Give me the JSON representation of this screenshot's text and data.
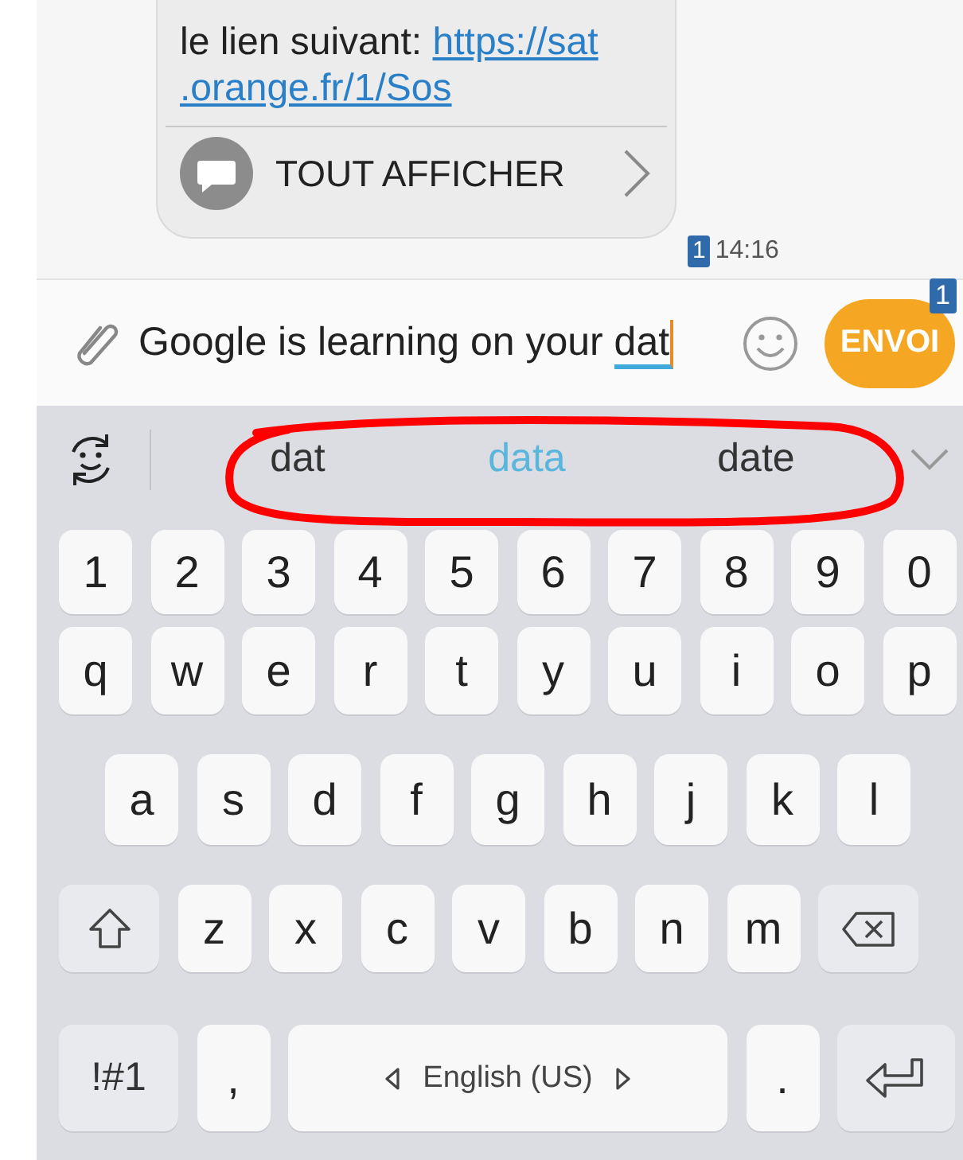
{
  "message": {
    "text": "le lien suivant: ",
    "link_lines": [
      "https://sat",
      ".orange.fr/1/Sos"
    ],
    "action": "TOUT AFFICHER",
    "sim": "1",
    "time": "14:16"
  },
  "compose": {
    "text": "Google is learning on your ",
    "composing": "dat",
    "send": "ENVOI",
    "send_badge": "1"
  },
  "suggestions": [
    {
      "text": "dat",
      "selected": false
    },
    {
      "text": "data",
      "selected": true
    },
    {
      "text": "date",
      "selected": false
    }
  ],
  "annotation": {
    "kind": "ellipse"
  },
  "keyboard": [
    [
      {
        "kind": "char",
        "label": "1"
      },
      {
        "kind": "char",
        "label": "2"
      },
      {
        "kind": "char",
        "label": "3"
      },
      {
        "kind": "char",
        "label": "4"
      },
      {
        "kind": "char",
        "label": "5"
      },
      {
        "kind": "char",
        "label": "6"
      },
      {
        "kind": "char",
        "label": "7"
      },
      {
        "kind": "char",
        "label": "8"
      },
      {
        "kind": "char",
        "label": "9"
      },
      {
        "kind": "char",
        "label": "0"
      }
    ],
    [
      {
        "kind": "char",
        "label": "q"
      },
      {
        "kind": "char",
        "label": "w"
      },
      {
        "kind": "char",
        "label": "e"
      },
      {
        "kind": "char",
        "label": "r"
      },
      {
        "kind": "char",
        "label": "t"
      },
      {
        "kind": "char",
        "label": "y"
      },
      {
        "kind": "char",
        "label": "u"
      },
      {
        "kind": "char",
        "label": "i"
      },
      {
        "kind": "char",
        "label": "o"
      },
      {
        "kind": "char",
        "label": "p"
      }
    ],
    [
      {
        "kind": "char",
        "label": "a"
      },
      {
        "kind": "char",
        "label": "s"
      },
      {
        "kind": "char",
        "label": "d"
      },
      {
        "kind": "char",
        "label": "f"
      },
      {
        "kind": "char",
        "label": "g"
      },
      {
        "kind": "char",
        "label": "h"
      },
      {
        "kind": "char",
        "label": "j"
      },
      {
        "kind": "char",
        "label": "k"
      },
      {
        "kind": "char",
        "label": "l"
      }
    ],
    [
      {
        "kind": "shift"
      },
      {
        "kind": "char",
        "label": "z"
      },
      {
        "kind": "char",
        "label": "x"
      },
      {
        "kind": "char",
        "label": "c"
      },
      {
        "kind": "char",
        "label": "v"
      },
      {
        "kind": "char",
        "label": "b"
      },
      {
        "kind": "char",
        "label": "n"
      },
      {
        "kind": "char",
        "label": "m"
      },
      {
        "kind": "backspace"
      }
    ],
    [
      {
        "kind": "symbols",
        "label": "!#1"
      },
      {
        "kind": "char",
        "label": ","
      },
      {
        "kind": "space",
        "label": "English (US)"
      },
      {
        "kind": "char",
        "label": "."
      },
      {
        "kind": "enter"
      }
    ]
  ]
}
